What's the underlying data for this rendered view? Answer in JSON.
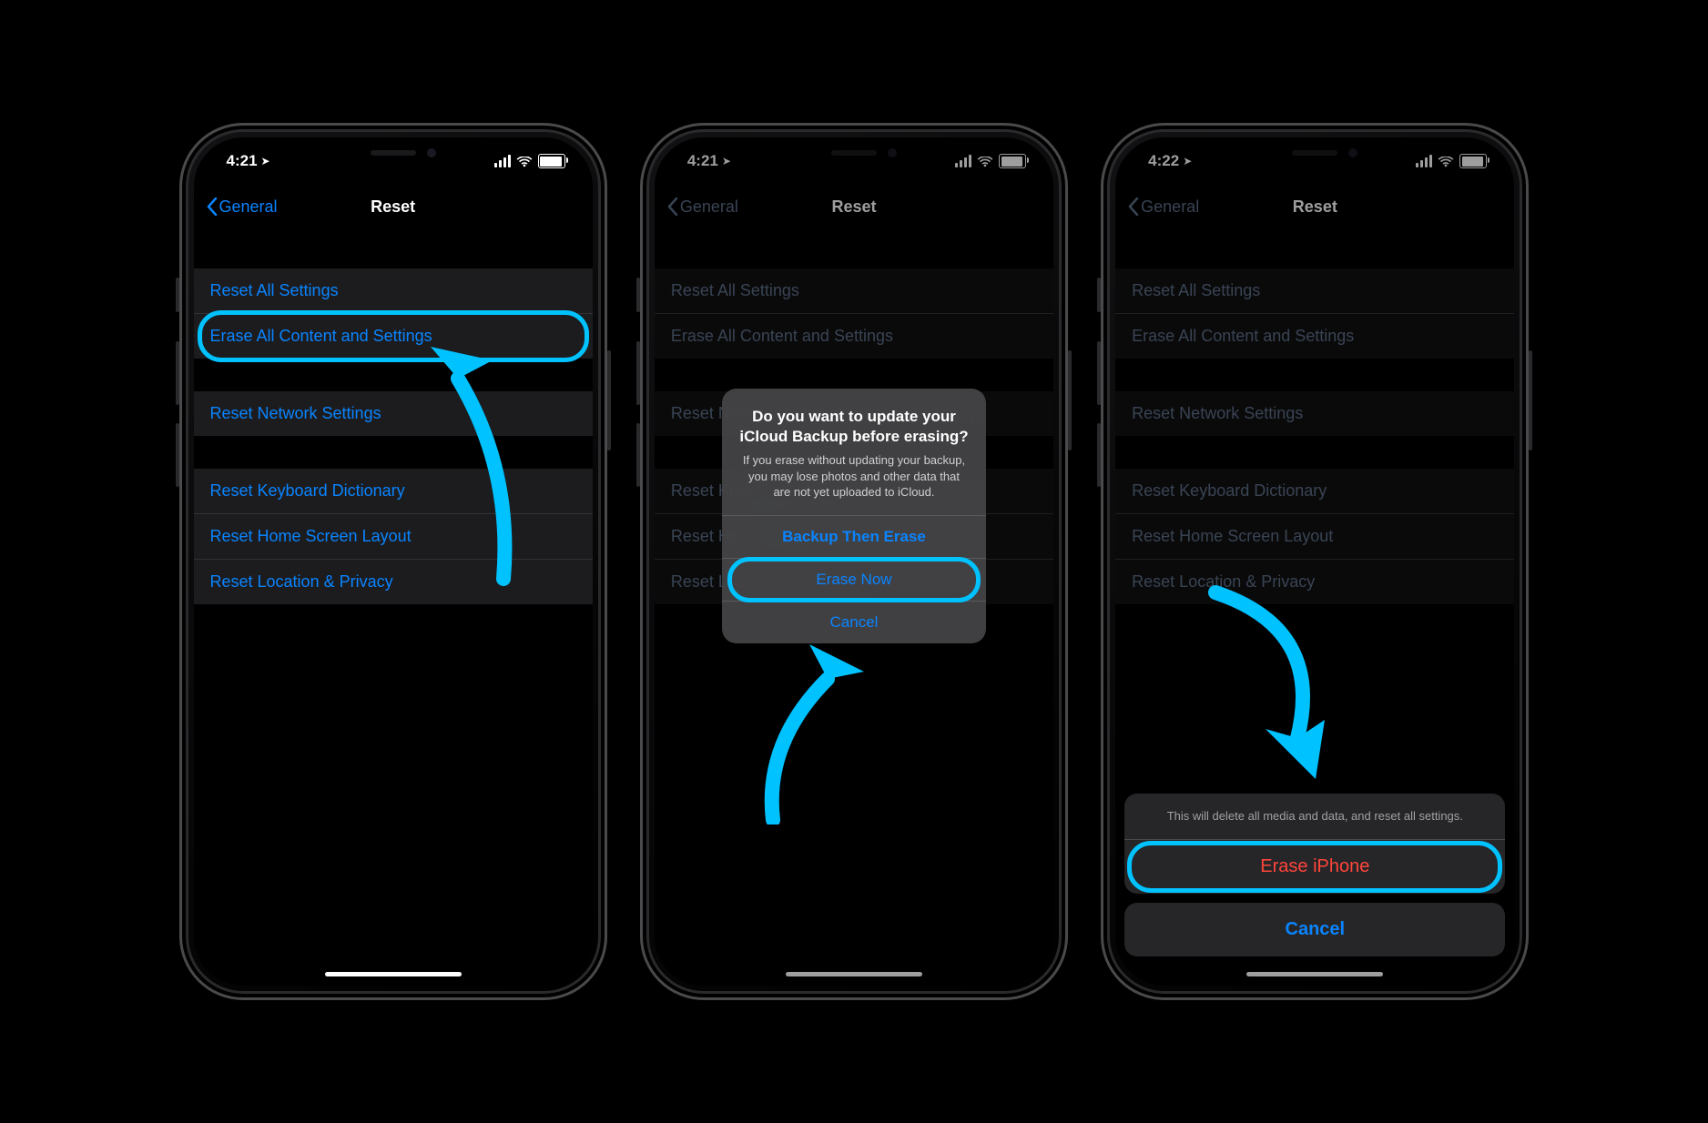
{
  "colors": {
    "highlight": "#00c2ff",
    "link": "#0a84ff",
    "destructive": "#ff453a"
  },
  "phones": [
    {
      "time": "4:21",
      "back": "General",
      "title": "Reset",
      "groups": [
        [
          "Reset All Settings",
          "Erase All Content and Settings"
        ],
        [
          "Reset Network Settings"
        ],
        [
          "Reset Keyboard Dictionary",
          "Reset Home Screen Layout",
          "Reset Location & Privacy"
        ]
      ],
      "highlight_cell": "Erase All Content and Settings"
    },
    {
      "time": "4:21",
      "back": "General",
      "title": "Reset",
      "groups": [
        [
          "Reset All Settings",
          "Erase All Content and Settings"
        ],
        [
          "Reset Network Settings"
        ],
        [
          "Reset Keyboard Dictionary",
          "Reset Home Screen Layout",
          "Reset Location & Privacy"
        ]
      ],
      "alert": {
        "title": "Do you want to update your iCloud Backup before erasing?",
        "body": "If you erase without updating your backup, you may lose photos and other data that are not yet uploaded to iCloud.",
        "buttons": [
          "Backup Then Erase",
          "Erase Now",
          "Cancel"
        ],
        "highlight_button": "Erase Now"
      }
    },
    {
      "time": "4:22",
      "back": "General",
      "title": "Reset",
      "groups": [
        [
          "Reset All Settings",
          "Erase All Content and Settings"
        ],
        [
          "Reset Network Settings"
        ],
        [
          "Reset Keyboard Dictionary",
          "Reset Home Screen Layout",
          "Reset Location & Privacy"
        ]
      ],
      "actionSheet": {
        "message": "This will delete all media and data, and reset all settings.",
        "destructive": "Erase iPhone",
        "cancel": "Cancel",
        "highlight_button": "Erase iPhone"
      }
    }
  ]
}
